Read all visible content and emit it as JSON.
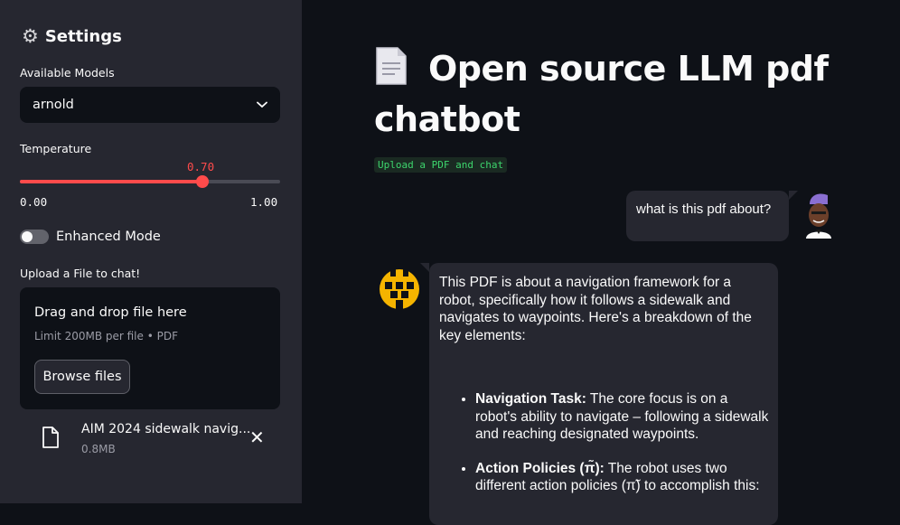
{
  "sidebar": {
    "title": "Settings",
    "models_label": "Available Models",
    "model_selected": "arnold",
    "temperature_label": "Temperature",
    "temperature_value": "0.70",
    "temperature_level": 0.7,
    "temperature_min": "0.00",
    "temperature_max": "1.00",
    "enhanced_mode_label": "Enhanced Mode",
    "enhanced_mode_on": false,
    "upload_label": "Upload a File to chat!",
    "dropzone_title": "Drag and drop file here",
    "dropzone_limit": "Limit 200MB per file • PDF",
    "browse_label": "Browse files",
    "file_name": "AIM 2024 sidewalk navig...",
    "file_size": "0.8MB"
  },
  "main": {
    "title": "Open source LLM pdf chatbot",
    "caption": "Upload a PDF and chat",
    "user_message": "what is this pdf about?",
    "bot_intro": "This PDF is about a navigation framework for a robot, specifically how it follows a sidewalk and navigates to waypoints. Here's a breakdown of the key elements:",
    "bullets": [
      {
        "head": "Navigation Task:",
        "text": " The core focus is on a robot's ability to navigate – following a sidewalk and reaching designated waypoints."
      },
      {
        "head": "Action Policies (π̃):",
        "text": " The robot uses two different action policies (π̃) to accomplish this:"
      }
    ]
  },
  "colors": {
    "accent": "#ff4b4b",
    "sidebar_bg": "#262730",
    "main_bg": "#0e1117",
    "caption_green": "#3dd56d"
  }
}
